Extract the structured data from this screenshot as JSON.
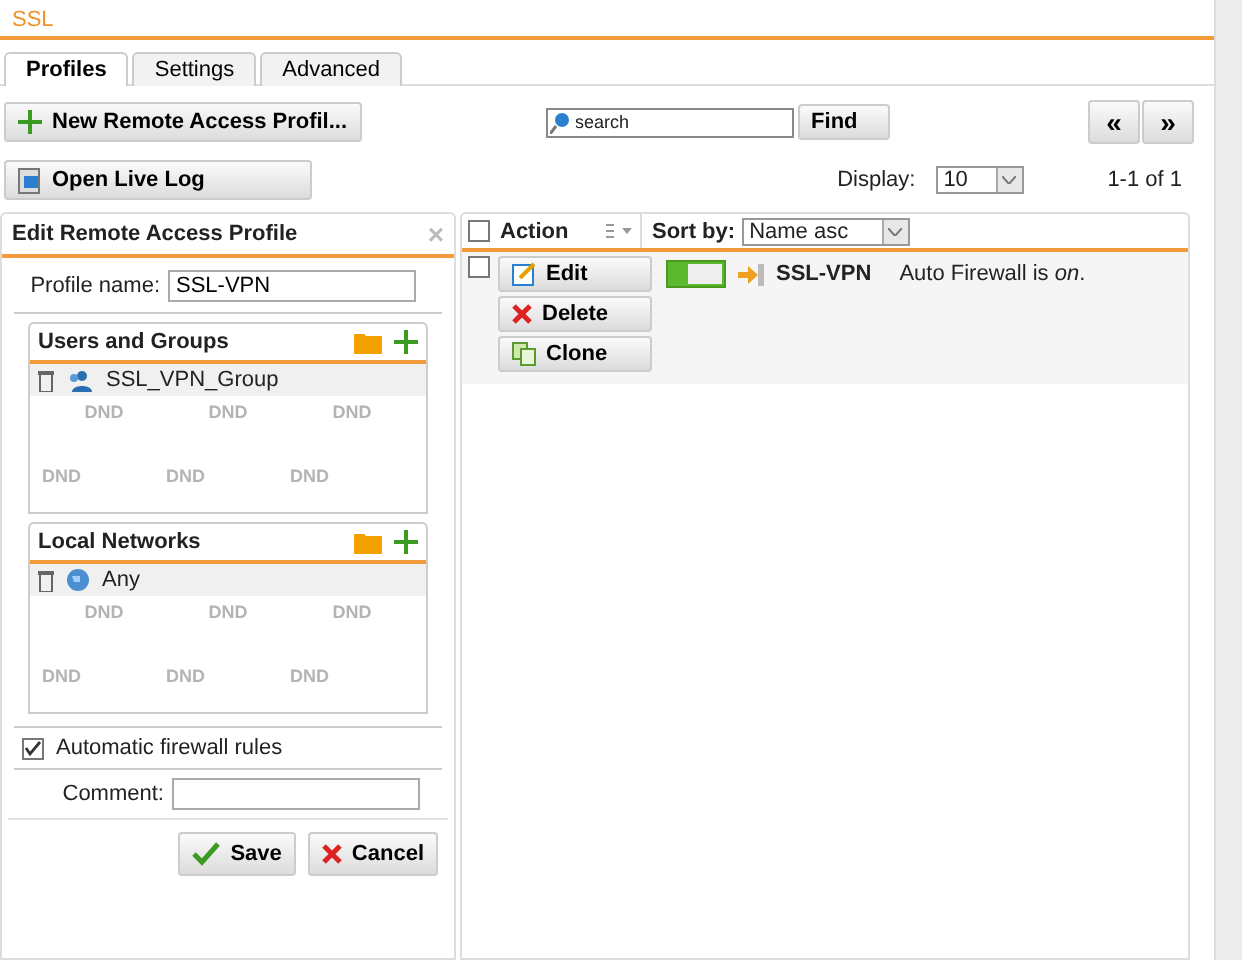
{
  "window": {
    "title": "SSL"
  },
  "tabs": [
    {
      "label": "Profiles",
      "selected": true
    },
    {
      "label": "Settings",
      "selected": false
    },
    {
      "label": "Advanced",
      "selected": false
    }
  ],
  "toolbar": {
    "new_button": "New Remote Access Profil...",
    "live_log_button": "Open Live Log",
    "search": {
      "placeholder": "search"
    },
    "find_button": "Find",
    "prev_button": "«",
    "next_button": "»",
    "display_label": "Display:",
    "display_value": "10",
    "page_info": "1-1 of 1"
  },
  "editor": {
    "title": "Edit Remote Access Profile",
    "close": "×",
    "profile_name_label": "Profile name:",
    "profile_name": "SSL-VPN",
    "sections": [
      {
        "title": "Users and Groups",
        "items": [
          {
            "label": "SSL_VPN_Group",
            "kind": "group"
          }
        ],
        "drop_hints": [
          "DND",
          "DND",
          "DND",
          "DND",
          "DND",
          "DND"
        ]
      },
      {
        "title": "Local Networks",
        "items": [
          {
            "label": "Any",
            "kind": "network"
          }
        ],
        "drop_hints": [
          "DND",
          "DND",
          "DND",
          "DND",
          "DND",
          "DND"
        ]
      }
    ],
    "auto_firewall": {
      "label": "Automatic firewall rules",
      "checked": true
    },
    "comment_label": "Comment:",
    "save_button": "Save",
    "cancel_button": "Cancel"
  },
  "list": {
    "action_header": "Action",
    "header_checked": false,
    "sort_label": "Sort by:",
    "sort_value": "Name asc",
    "rows": [
      {
        "checked": false,
        "actions": [
          "Edit",
          "Delete",
          "Clone"
        ],
        "on": true,
        "name": "SSL-VPN",
        "description": "Auto Firewall is *on*."
      }
    ]
  }
}
